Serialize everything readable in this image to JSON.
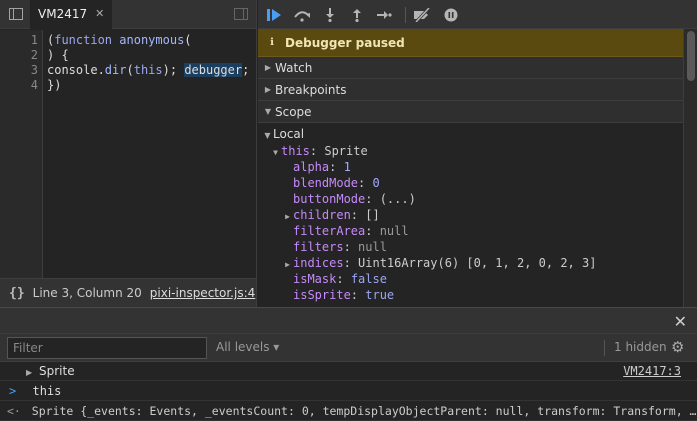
{
  "sources": {
    "tab_title": "VM2417",
    "tab_close": "✕",
    "line_numbers": [
      "1",
      "2",
      "3",
      "4"
    ],
    "code": {
      "l1_open": "(",
      "l1_kw": "function",
      "l1_name": "anonymous",
      "l1_paren": "(",
      "l2": ") {",
      "l3_pre": "console.",
      "l3_fn": "dir",
      "l3_open": "(",
      "l3_this": "this",
      "l3_close": "); ",
      "l3_dbg": "debugger",
      "l3_semi": ";",
      "l4": "})"
    },
    "status": {
      "pretty": "{}",
      "position": "Line 3, Column 20",
      "link": "pixi-inspector.js:4",
      "coverage": "Co"
    }
  },
  "debugger": {
    "paused": "Debugger paused",
    "sections": {
      "watch": "Watch",
      "breakpoints": "Breakpoints",
      "scope": "Scope"
    },
    "scope": {
      "local": "Local",
      "this_label": "this",
      "this_type": ": Sprite",
      "props": [
        {
          "name": "alpha",
          "sep": ": ",
          "value": "1",
          "kind": "num",
          "expand": false
        },
        {
          "name": "blendMode",
          "sep": ": ",
          "value": "0",
          "kind": "num",
          "expand": false
        },
        {
          "name": "buttonMode",
          "sep": ": ",
          "value": "(...)",
          "kind": "val",
          "expand": false
        },
        {
          "name": "children",
          "sep": ": ",
          "value": "[]",
          "kind": "val",
          "expand": true
        },
        {
          "name": "filterArea",
          "sep": ": ",
          "value": "null",
          "kind": "gray",
          "expand": false
        },
        {
          "name": "filters",
          "sep": ": ",
          "value": "null",
          "kind": "gray",
          "expand": false
        },
        {
          "name": "indices",
          "sep": ": ",
          "value": "Uint16Array(6) [0, 1, 2, 0, 2, 3]",
          "kind": "val",
          "expand": true
        },
        {
          "name": "isMask",
          "sep": ": ",
          "value": "false",
          "kind": "kwv",
          "expand": false
        },
        {
          "name": "isSprite",
          "sep": ": ",
          "value": "true",
          "kind": "kwv",
          "expand": false
        }
      ]
    }
  },
  "drawer": {
    "close": "✕"
  },
  "console": {
    "filter_placeholder": "Filter",
    "levels": "All levels ▾",
    "hidden": "1 hidden",
    "rows": {
      "sprite_label": "Sprite",
      "source_link": "VM2417:3",
      "input_prompt": ">",
      "input_text": "this",
      "result_prompt": "<·",
      "result_text": "Sprite {_events: Events, _eventsCount: 0, tempDisplayObjectParent: null, transform: Transform, …"
    }
  }
}
